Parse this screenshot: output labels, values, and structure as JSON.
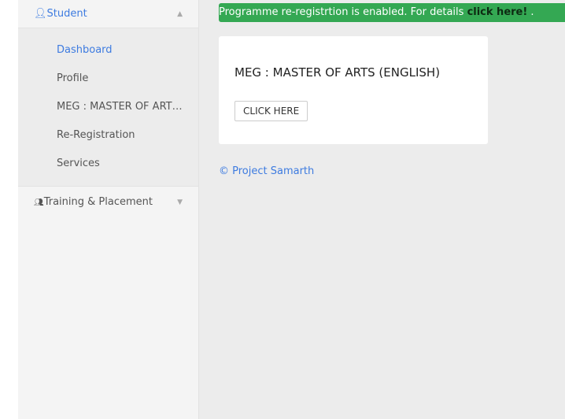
{
  "sidebar": {
    "student_label": "Student",
    "items": [
      {
        "label": "Dashboard"
      },
      {
        "label": "Profile"
      },
      {
        "label": "MEG : MASTER OF ARTS (ENGLISH)"
      },
      {
        "label": "Re-Registration"
      },
      {
        "label": "Services"
      }
    ],
    "training_label": "Training & Placement"
  },
  "banner": {
    "text": "Programme re-registrtion is enabled. For details ",
    "link": "click here!",
    "suffix": " ."
  },
  "card": {
    "title": "MEG : MASTER OF ARTS (ENGLISH)",
    "button": "CLICK HERE"
  },
  "footer": {
    "text": "© Project Samarth"
  }
}
